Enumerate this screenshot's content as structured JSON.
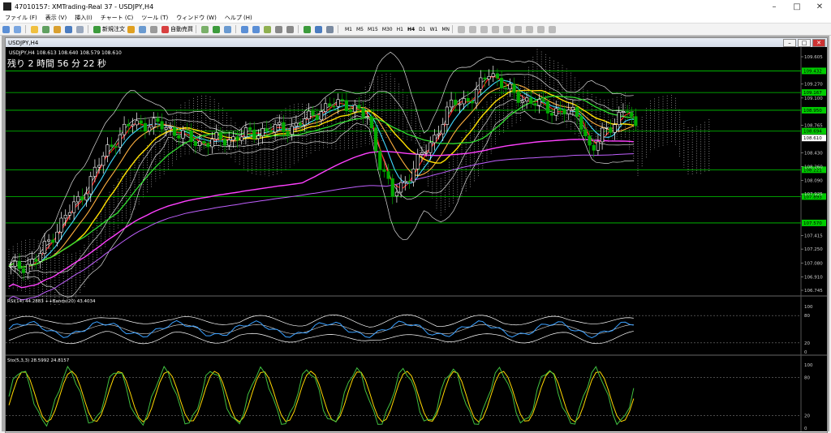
{
  "window": {
    "title": "47010157: XMTrading-Real 37 - USDJPY,H4",
    "minimize": "–",
    "maximize": "□",
    "close": "✕"
  },
  "menu": [
    "ファイル (F)",
    "表示 (V)",
    "挿入(I)",
    "チャート (C)",
    "ツール (T)",
    "ウィンドウ (W)",
    "ヘルプ (H)"
  ],
  "toolbar": {
    "new_order_label": "新規注文",
    "autotrade_label": "自動売買",
    "timeframes": [
      "M1",
      "M5",
      "M15",
      "M30",
      "H1",
      "H4",
      "D1",
      "W1",
      "MN"
    ],
    "active_timeframe": "H4"
  },
  "chart_window": {
    "title": "USDJPY,H4"
  },
  "main_chart": {
    "info": "USDJPY,H4  108.613 108.640 108.579 108.610",
    "countdown": "残り 2 時間 56 分 22 秒",
    "price_scale": [
      "109.605",
      "109.270",
      "109.100",
      "108.765",
      "108.430",
      "108.260",
      "108.090",
      "107.925",
      "107.415",
      "107.250",
      "107.080",
      "106.910",
      "106.745"
    ],
    "level_labels": [
      "109.432",
      "109.167",
      "108.950",
      "108.694",
      "108.221",
      "107.893",
      "107.570"
    ],
    "current_price": "108.610",
    "colors": {
      "background": "#000000",
      "level": "#00cc00",
      "candle_up": "#ffffff",
      "candle_down": "#00aa00",
      "ma_red": "#ff2020",
      "ma_yellow": "#ffe000",
      "ma_green": "#30e030",
      "ma_cyan": "#40d8ff",
      "ma_magenta": "#ff40ff",
      "ma_orange": "#ffb040",
      "bands": "#ffffff",
      "cloud": "#ffffff"
    }
  },
  "rsi_pane": {
    "label": "RSI(14) 44.2883  ++Bands(20) 43.4034",
    "scale": [
      "100",
      "80",
      "20",
      "0"
    ]
  },
  "stoch_pane": {
    "label": "Sto(5,3,3) 28.5992 24.8157",
    "scale": [
      "100",
      "80",
      "20",
      "0"
    ]
  }
}
